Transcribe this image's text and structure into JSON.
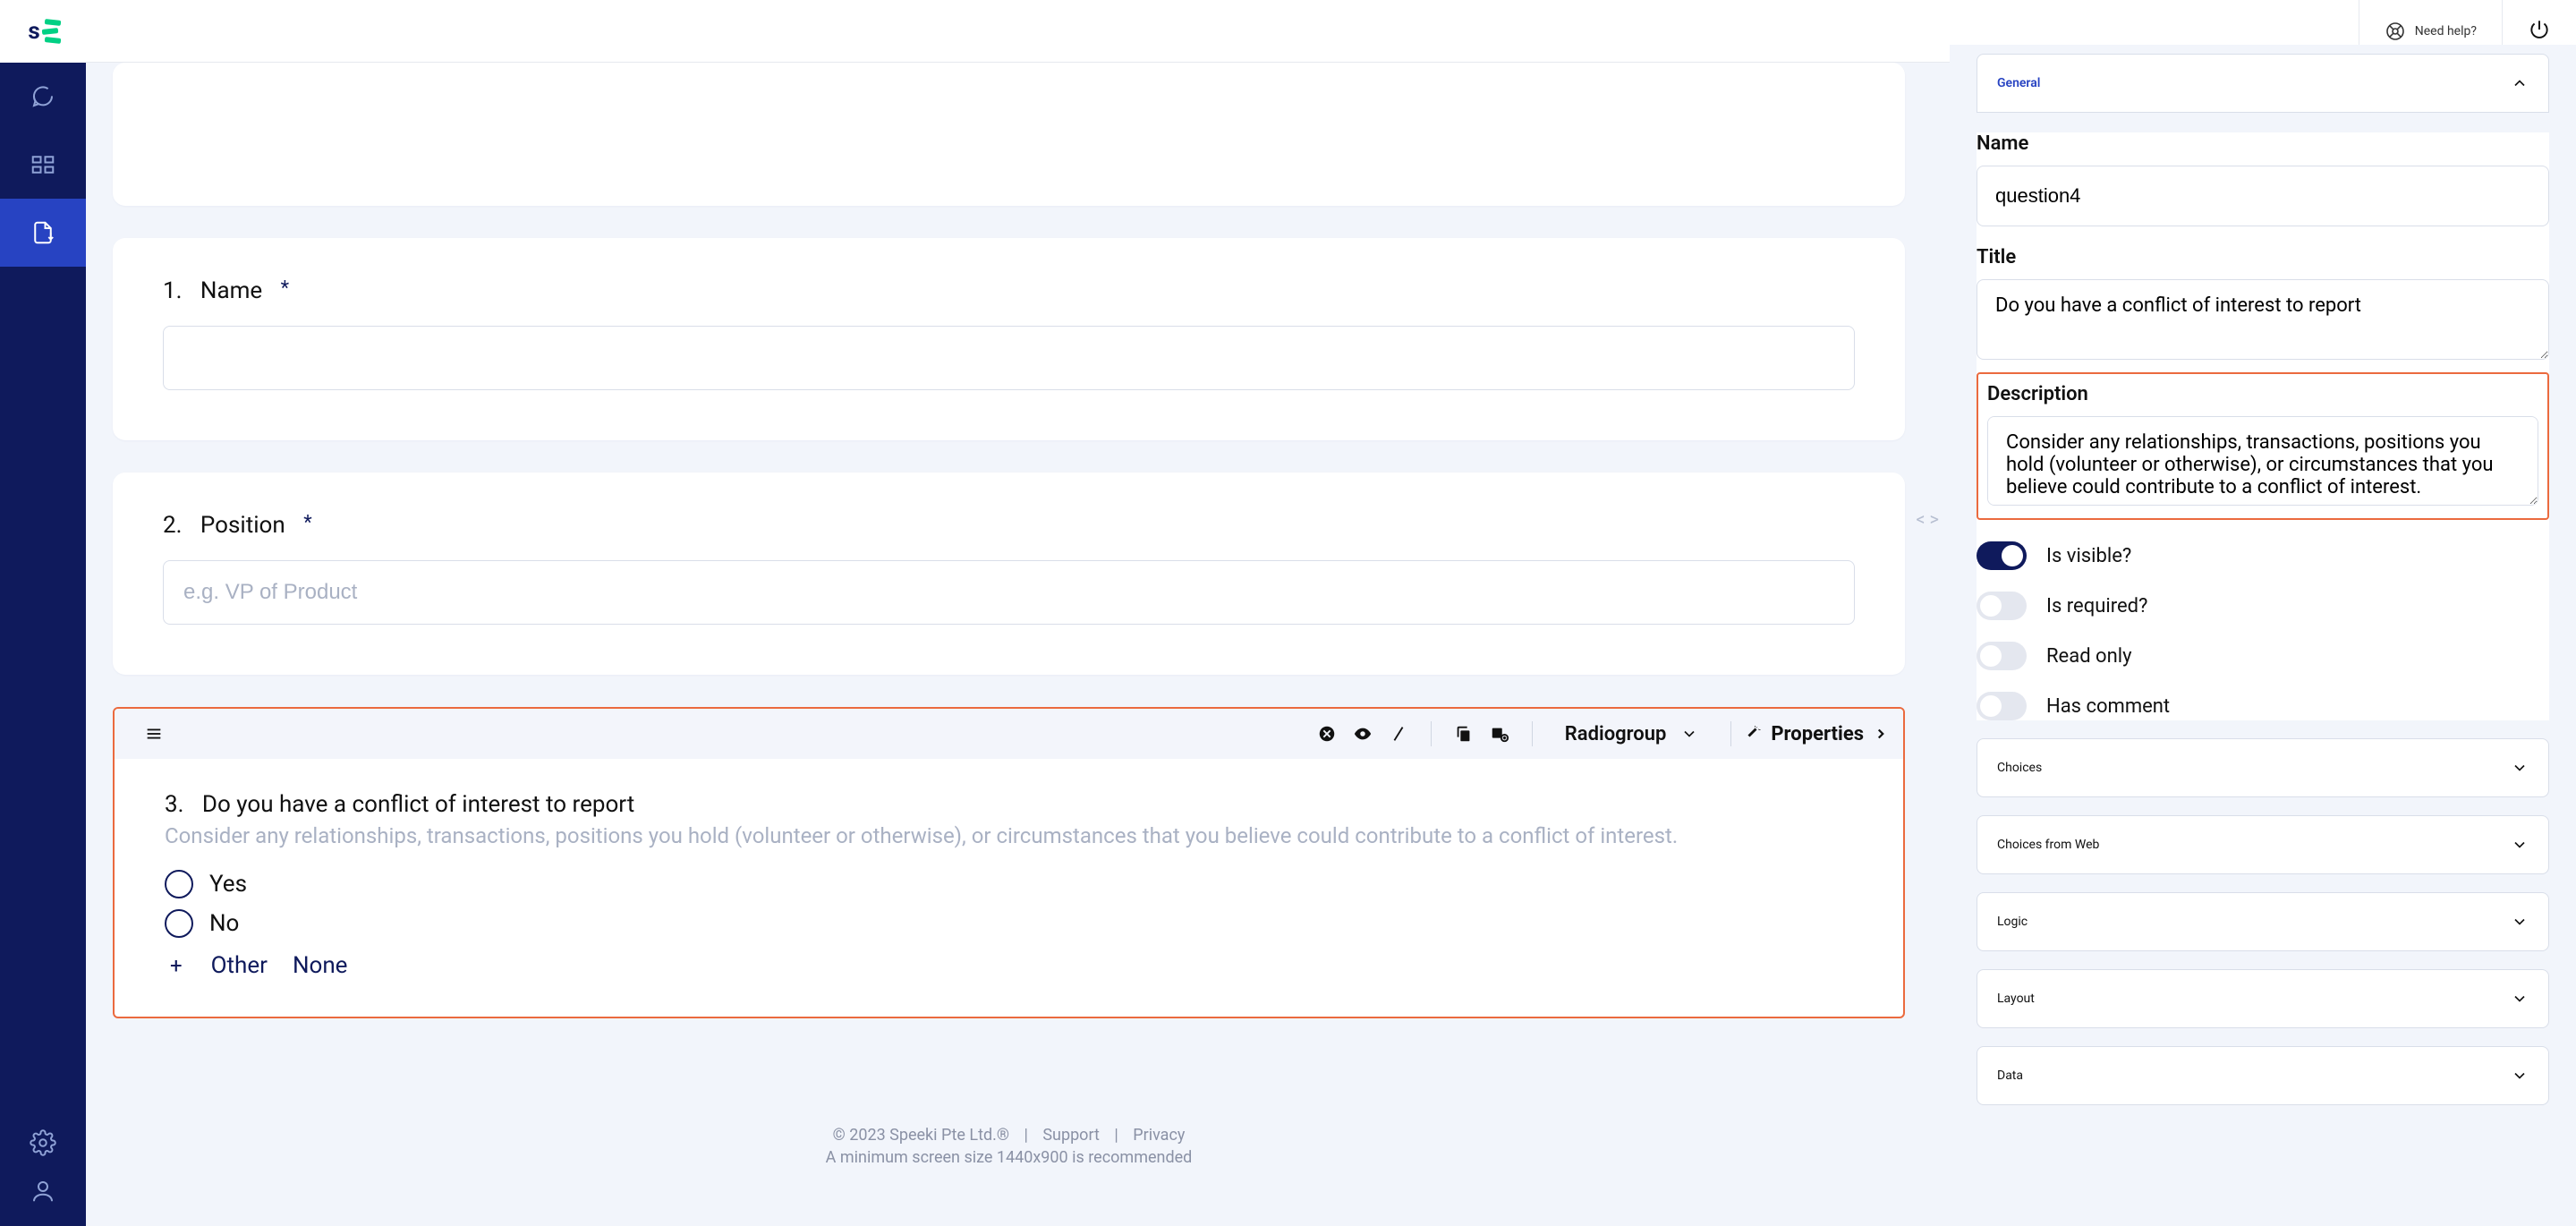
{
  "header": {
    "need_help": "Need help?"
  },
  "sidebar": {
    "items": [
      "chat",
      "modules",
      "forms"
    ],
    "active": 2
  },
  "questions": {
    "q1": {
      "num": "1.",
      "label": "Name",
      "required": "*"
    },
    "q2": {
      "num": "2.",
      "label": "Position",
      "required": "*",
      "placeholder": "e.g. VP of Product"
    },
    "q3": {
      "num": "3.",
      "label": "Do you have a conflict of interest to report",
      "description": "Consider any relationships, transactions, positions you hold (volunteer or otherwise), or circumstances that you believe could contribute to a conflict of interest.",
      "opt_yes": "Yes",
      "opt_no": "No",
      "add_other": "Other",
      "add_none": "None"
    }
  },
  "toolbar": {
    "type": "Radiogroup",
    "properties": "Properties"
  },
  "panel": {
    "section_general": "General",
    "name_label": "Name",
    "name_value": "question4",
    "title_label": "Title",
    "title_value": "Do you have a conflict of interest to report",
    "description_label": "Description",
    "description_value": "Consider any relationships, transactions, positions you hold (volunteer or otherwise), or circumstances that you believe could contribute to a conflict of interest.",
    "is_visible": "Is visible?",
    "is_required": "Is required?",
    "read_only": "Read only",
    "has_comment": "Has comment",
    "choices": "Choices",
    "choices_web": "Choices from Web",
    "logic": "Logic",
    "layout": "Layout",
    "data": "Data"
  },
  "footer": {
    "copyright": "© 2023 Speeki Pte Ltd.®",
    "support": "Support",
    "privacy": "Privacy",
    "screen": "A minimum screen size 1440x900 is recommended"
  }
}
